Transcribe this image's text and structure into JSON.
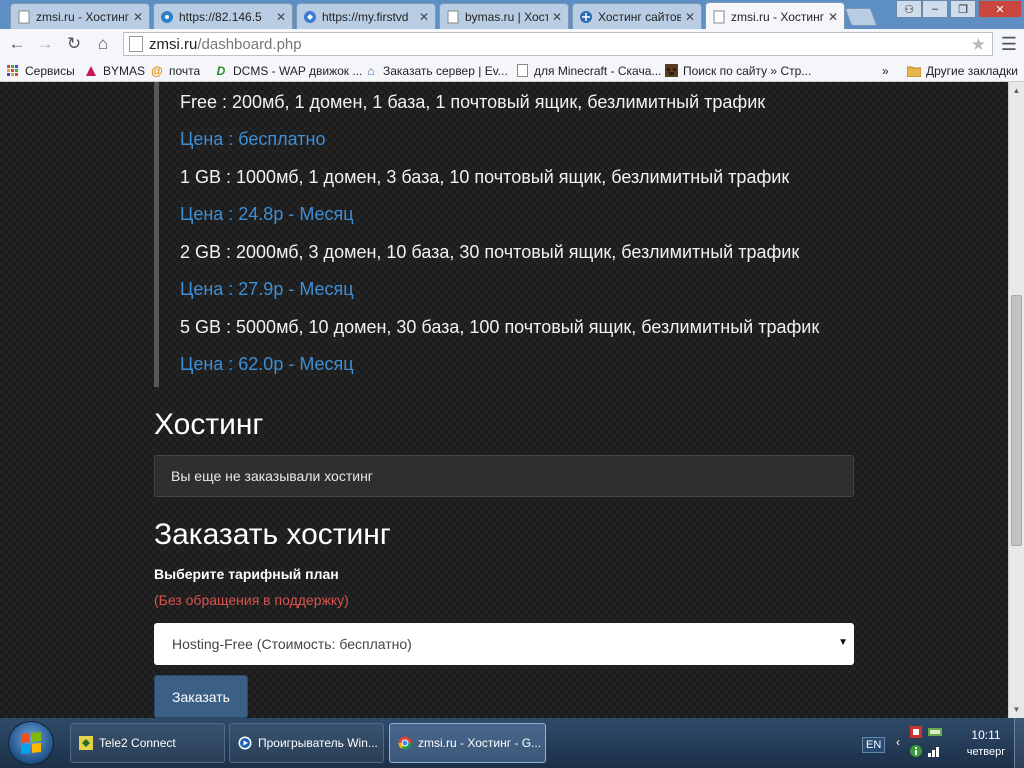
{
  "browser": {
    "tabs": [
      {
        "title": "zmsi.ru - Хостинг",
        "active": false
      },
      {
        "title": "https://82.146.5",
        "active": false
      },
      {
        "title": "https://my.firstvd",
        "active": false
      },
      {
        "title": "bymas.ru | Хости",
        "active": false
      },
      {
        "title": "Хостинг сайтов",
        "active": false
      },
      {
        "title": "zmsi.ru - Хостинг",
        "active": true
      }
    ],
    "window_controls": {
      "user": "⚇",
      "minimize": "–",
      "maximize": "❐",
      "close": "✕"
    },
    "address": {
      "host": "zmsi.ru",
      "path": "/dashboard.php"
    },
    "bookmarks": [
      {
        "label": "Сервисы",
        "icon": "apps-icon"
      },
      {
        "label": "BYMAS",
        "icon": "bymas-icon"
      },
      {
        "label": "почта",
        "icon": "mail-icon"
      },
      {
        "label": "DCMS - WAP движок ...",
        "icon": "dcms-icon"
      },
      {
        "label": "Заказать сервер | Ev...",
        "icon": "home-icon"
      },
      {
        "label": "для Minecraft - Скача...",
        "icon": "page-icon"
      },
      {
        "label": "Поиск по сайту » Стр...",
        "icon": "minecraft-icon"
      }
    ],
    "bookmarks_overflow": "»",
    "other_bookmarks": "Другие закладки"
  },
  "plans": [
    {
      "text": "Free : 200мб, 1 домен, 1 база, 1 почтовый ящик, безлимитный трафик",
      "price": "Цена : бесплатно"
    },
    {
      "text": "1 GB : 1000мб, 1 домен, 3 база, 10 почтовый ящик, безлимитный трафик",
      "price": "Цена : 24.8р - Месяц"
    },
    {
      "text": "2 GB : 2000мб, 3 домен, 10 база, 30 почтовый ящик, безлимитный трафик",
      "price": "Цена : 27.9р - Месяц"
    },
    {
      "text": "5 GB : 5000мб, 10 домен, 30 база, 100 почтовый ящик, безлимитный трафик",
      "price": "Цена : 62.0р - Месяц"
    }
  ],
  "hosting": {
    "title": "Хостинг",
    "notice": "Вы еще не заказывали хостинг"
  },
  "order": {
    "title": "Заказать хостинг",
    "plan_label": "Выберите тарифный план",
    "support_note": "(Без обращения в поддержку)",
    "selected_plan": "Hosting-Free (Стоимость: бесплатно)",
    "button": "Заказать"
  },
  "taskbar": {
    "tasks": [
      {
        "label": "Tele2 Connect",
        "active": false
      },
      {
        "label": "Проигрыватель Win...",
        "active": false
      },
      {
        "label": "zmsi.ru - Хостинг - G...",
        "active": true
      }
    ],
    "language": "EN",
    "time": "10:11",
    "day": "четверг"
  },
  "colors": {
    "price": "#3d8fd6",
    "support_note": "#d9534f",
    "button": "#3b5f85",
    "page_bg": "#1c1c1c"
  }
}
